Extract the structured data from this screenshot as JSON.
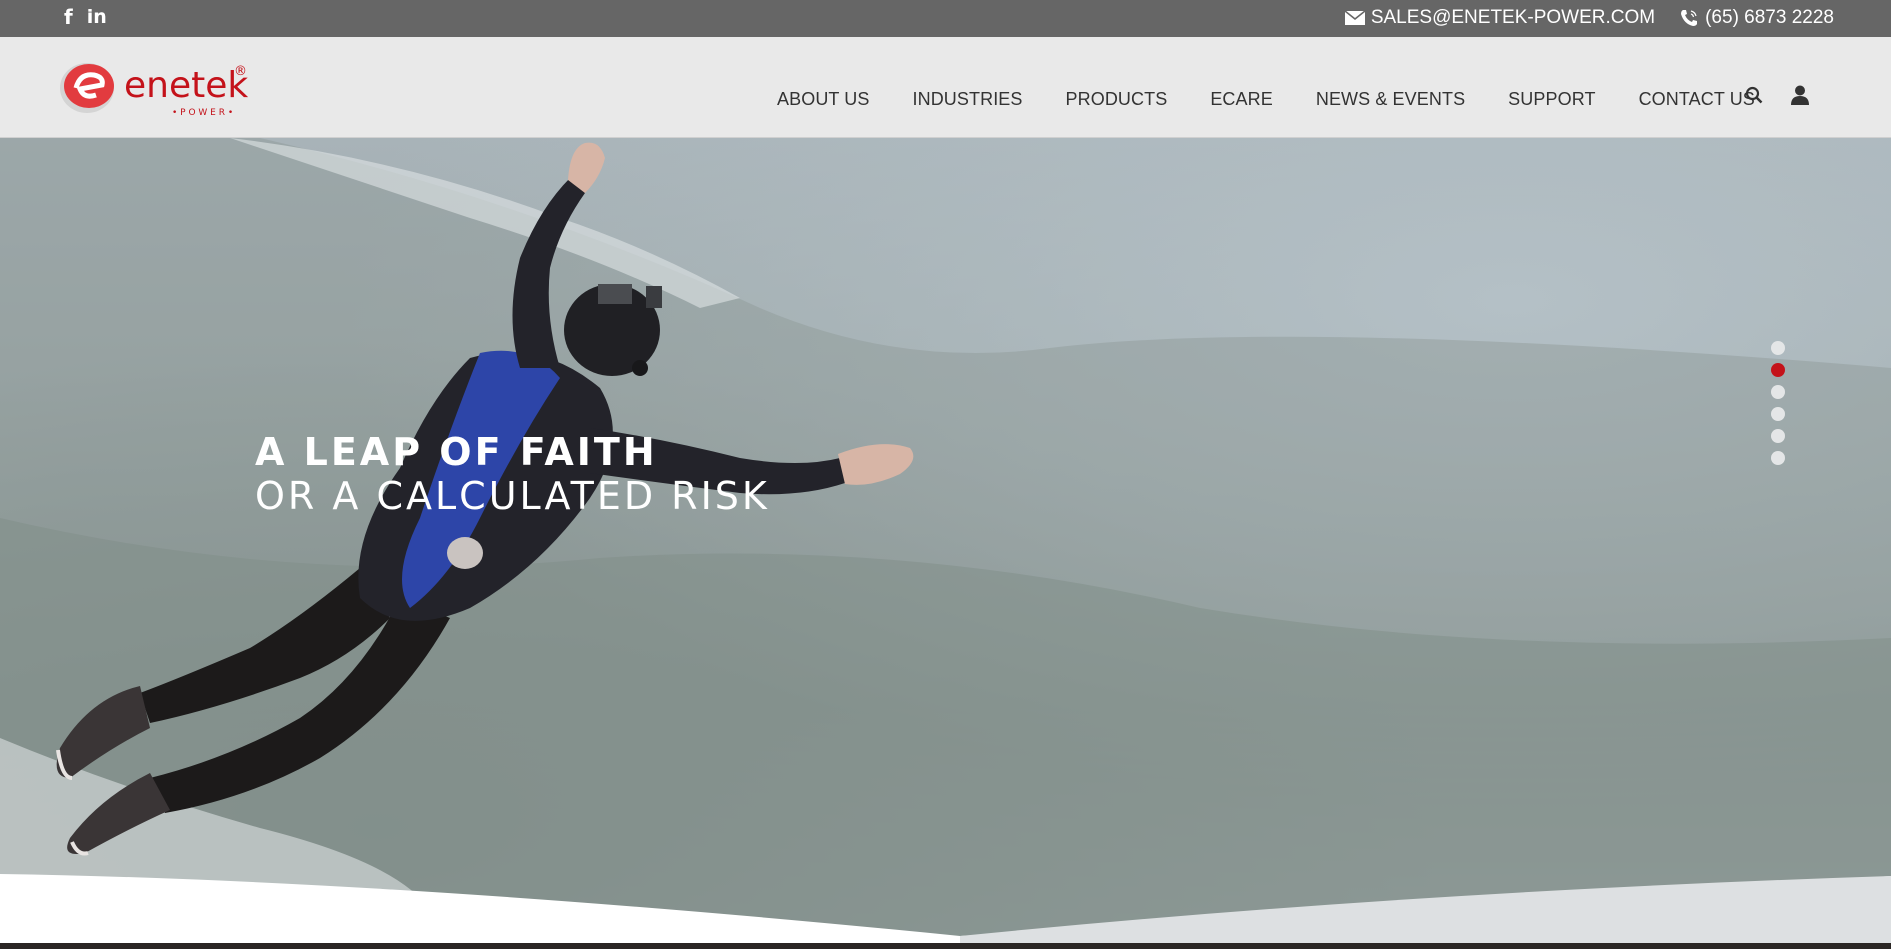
{
  "topbar": {
    "social": [
      {
        "icon": "facebook-icon",
        "glyph": "f"
      },
      {
        "icon": "linkedin-icon",
        "glyph": "in"
      }
    ],
    "email": "SALES@ENETEK-POWER.COM",
    "phone": "(65) 6873 2228"
  },
  "header": {
    "logo": {
      "name": "enetek",
      "sub": "• P O W E R •",
      "mark": "®"
    },
    "nav": [
      "ABOUT US",
      "INDUSTRIES",
      "PRODUCTS",
      "ECARE",
      "NEWS & EVENTS",
      "SUPPORT",
      "CONTACT US"
    ],
    "icons": [
      "search-icon",
      "user-icon"
    ]
  },
  "hero": {
    "line1": "A LEAP OF FAITH",
    "line2": "OR A CALCULATED RISK",
    "slides_total": 6,
    "active_slide": 2
  },
  "colors": {
    "topbar_bg": "#666666",
    "header_bg": "#e9e9e9",
    "brand_red": "#c4121a",
    "nav_text": "#333333"
  }
}
